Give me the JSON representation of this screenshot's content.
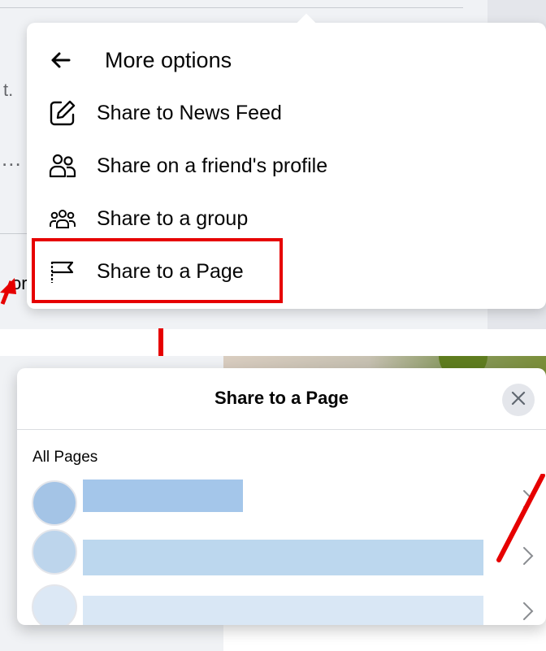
{
  "more_options_menu": {
    "back_icon": "arrow-left-icon",
    "title": "More options",
    "items": [
      {
        "label": "Share to News Feed",
        "icon": "edit-square-icon"
      },
      {
        "label": "Share on a friend's profile",
        "icon": "friends-icon"
      },
      {
        "label": "Share to a group",
        "icon": "group-icon"
      },
      {
        "label": "Share to a Page",
        "icon": "flag-icon"
      }
    ],
    "highlighted_item": "Share to a Page",
    "highlight_color": "#e60000"
  },
  "background_fragments": {
    "t": "t.",
    "dots": "...",
    "or": "or"
  },
  "share_dialog": {
    "title": "Share to a Page",
    "close_icon": "close-icon",
    "section_label": "All Pages",
    "pages": [
      {
        "avatar_color": "#a4c4e6",
        "name_bar_color": "#a4c6ea",
        "chevron": "chevron-right-icon"
      },
      {
        "avatar_color": "#bdd5ec",
        "name_bar_color": "#bcd7ee",
        "chevron": "chevron-right-icon"
      },
      {
        "avatar_color": "#dce8f5",
        "name_bar_color": "#d9e7f5",
        "chevron": "chevron-right-icon"
      }
    ]
  },
  "annotation_color": "#e60000"
}
